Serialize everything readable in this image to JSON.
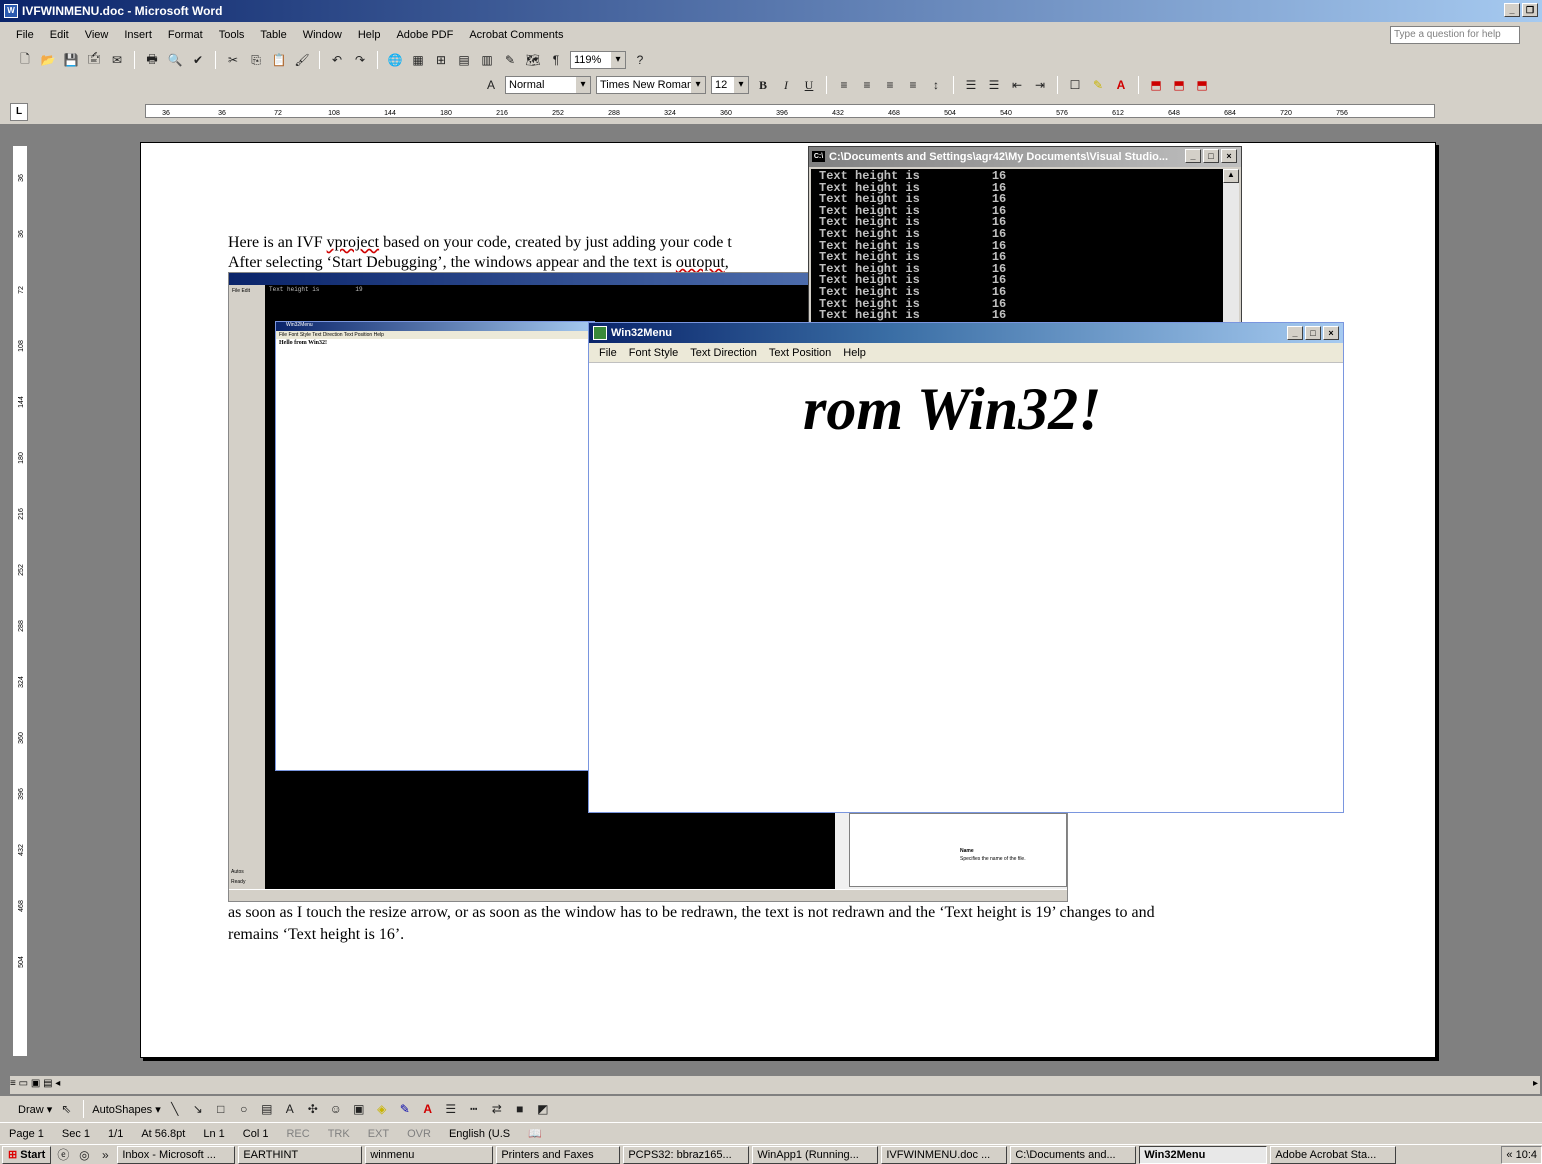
{
  "window": {
    "title": "IVFWINMENU.doc - Microsoft Word",
    "app_icon": "W"
  },
  "menu": {
    "items": [
      "File",
      "Edit",
      "View",
      "Insert",
      "Format",
      "Tools",
      "Table",
      "Window",
      "Help",
      "Adobe PDF",
      "Acrobat Comments"
    ],
    "help_placeholder": "Type a question for help"
  },
  "toolbar": {
    "zoom": "119%",
    "pilcrow": "¶"
  },
  "format": {
    "style": "Normal",
    "font": "Times New Roman",
    "size": "12",
    "bold": "B",
    "italic": "I",
    "underline": "U"
  },
  "ruler": {
    "corner": "L",
    "h_ticks": [
      "36",
      "36",
      "72",
      "108",
      "144",
      "180",
      "216",
      "252",
      "288",
      "324",
      "360",
      "396",
      "432",
      "468",
      "504",
      "540",
      "576",
      "612",
      "648",
      "684",
      "720",
      "756"
    ],
    "v_ticks": [
      "36",
      "36",
      "72",
      "108",
      "144",
      "180",
      "216",
      "252",
      "288",
      "324",
      "360",
      "396",
      "432",
      "468",
      "504"
    ]
  },
  "document": {
    "line1_pre": "Here is an IVF ",
    "line1_squig": "vproject",
    "line1_post": " based on your code, created by just adding your code t",
    "line2_pre": "After selecting ‘Start Debugging’, the windows appear and the text is ",
    "line2_squig": "outoput",
    "line2_post": ",",
    "line3": "as soon as I touch the resize arrow, or as soon as the window has to be redrawn, the text is not redrawn and the ‘Text height is   19’ changes to and",
    "line4": "remains ‘Text height is 16’."
  },
  "console": {
    "title": "C:\\Documents and Settings\\agr42\\My Documents\\Visual Studio...",
    "lines": [
      "Text height is          16",
      "Text height is          16",
      "Text height is          16",
      "Text height is          16",
      "Text height is          16",
      "Text height is          16",
      "Text height is          16",
      "Text height is          16",
      "Text height is          16",
      "Text height is          16",
      "Text height is          16",
      "Text height is          16",
      "Text height is          16"
    ]
  },
  "win32": {
    "title": "Win32Menu",
    "menu": [
      "File",
      "Font Style",
      "Text Direction",
      "Text Position",
      "Help"
    ],
    "big_text": "rom Win32!"
  },
  "embedded": {
    "console_line": "Text height is          19",
    "small_title": "Win32Menu",
    "small_menu": "File  Font Style  Text Direction  Text Position  Help",
    "small_hello": "Hello from Win32!",
    "word_menu": "File  Edit",
    "name_label": "Name",
    "name_desc": "Specifies the name of the file.",
    "autos": "Autos",
    "ready": "Ready",
    "name_col": "Name"
  },
  "drawbar": {
    "draw": "Draw ▾",
    "autoshapes": "AutoShapes ▾"
  },
  "status": {
    "page": "Page 1",
    "sec": "Sec 1",
    "pages": "1/1",
    "at": "At 56.8pt",
    "ln": "Ln 1",
    "col": "Col 1",
    "rec": "REC",
    "trk": "TRK",
    "ext": "EXT",
    "ovr": "OVR",
    "lang": "English (U.S"
  },
  "taskbar": {
    "start": "Start",
    "tasks": [
      "Inbox - Microsoft ...",
      "EARTHINT",
      "winmenu",
      "Printers and Faxes",
      "PCPS32: bbraz165...",
      "WinApp1 (Running...",
      "IVFWINMENU.doc ...",
      "C:\\Documents and...",
      "Win32Menu",
      "Adobe Acrobat Sta..."
    ],
    "active_index": 8,
    "clock": "10:4"
  },
  "colors": {
    "title_active": "#0a246a",
    "title_gradient_end": "#a6caf0",
    "chrome": "#d4d0c8",
    "squiggle": "#d00000"
  }
}
